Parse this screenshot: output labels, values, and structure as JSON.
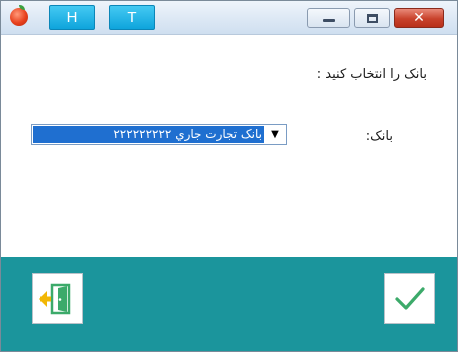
{
  "titlebar": {
    "buttons": [
      {
        "label": "H"
      },
      {
        "label": "T"
      }
    ],
    "controls": {
      "close_glyph": "✕"
    }
  },
  "main": {
    "prompt": "بانک را انتخاب کنید :",
    "bank_label": "بانک:",
    "bank_select": {
      "selected": "بانک تجارت جاري ۲۲۲۲۲۲۲۲۲",
      "arrow_icon": "chevron-down-icon"
    }
  },
  "footer": {
    "background": "#1b959c",
    "exit_icon": "exit-door-icon",
    "ok_icon": "checkmark-icon",
    "accent_green": "#3caa6a",
    "accent_yellow": "#f2b705"
  }
}
